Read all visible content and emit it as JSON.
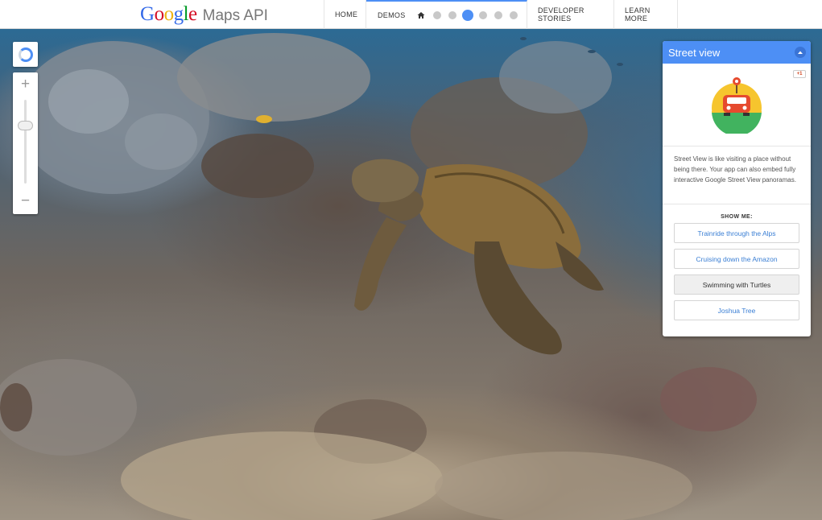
{
  "header": {
    "logo_google": [
      "G",
      "o",
      "o",
      "g",
      "l",
      "e"
    ],
    "logo_colors": [
      "#3369e8",
      "#d50f25",
      "#eeb211",
      "#3369e8",
      "#009925",
      "#d50f25"
    ],
    "logo_product": "Maps API",
    "nav": {
      "home": "HOME",
      "demos": "DEMOS",
      "developer_stories": "DEVELOPER STORIES",
      "learn_more": "LEARN MORE"
    },
    "demo_dots_count": 6,
    "active_dot_index": 2,
    "accent": "#4d8ff5"
  },
  "map_controls": {
    "zoom_in": "+",
    "zoom_out": "−"
  },
  "panel": {
    "title": "Street view",
    "gplus_label": "+1",
    "description": "Street View is like visiting a place without being there. Your app can also embed fully interactive Google Street View panoramas.",
    "show_me_label": "SHOW ME:",
    "options": [
      {
        "label": "Trainride through the Alps",
        "active": false
      },
      {
        "label": "Cruising down the Amazon",
        "active": false
      },
      {
        "label": "Swimming with Turtles",
        "active": true
      },
      {
        "label": "Joshua Tree",
        "active": false
      }
    ]
  },
  "icons": {
    "home": "home-icon",
    "collapse": "chevron-up-icon",
    "illustration": "street-view-car-icon"
  }
}
